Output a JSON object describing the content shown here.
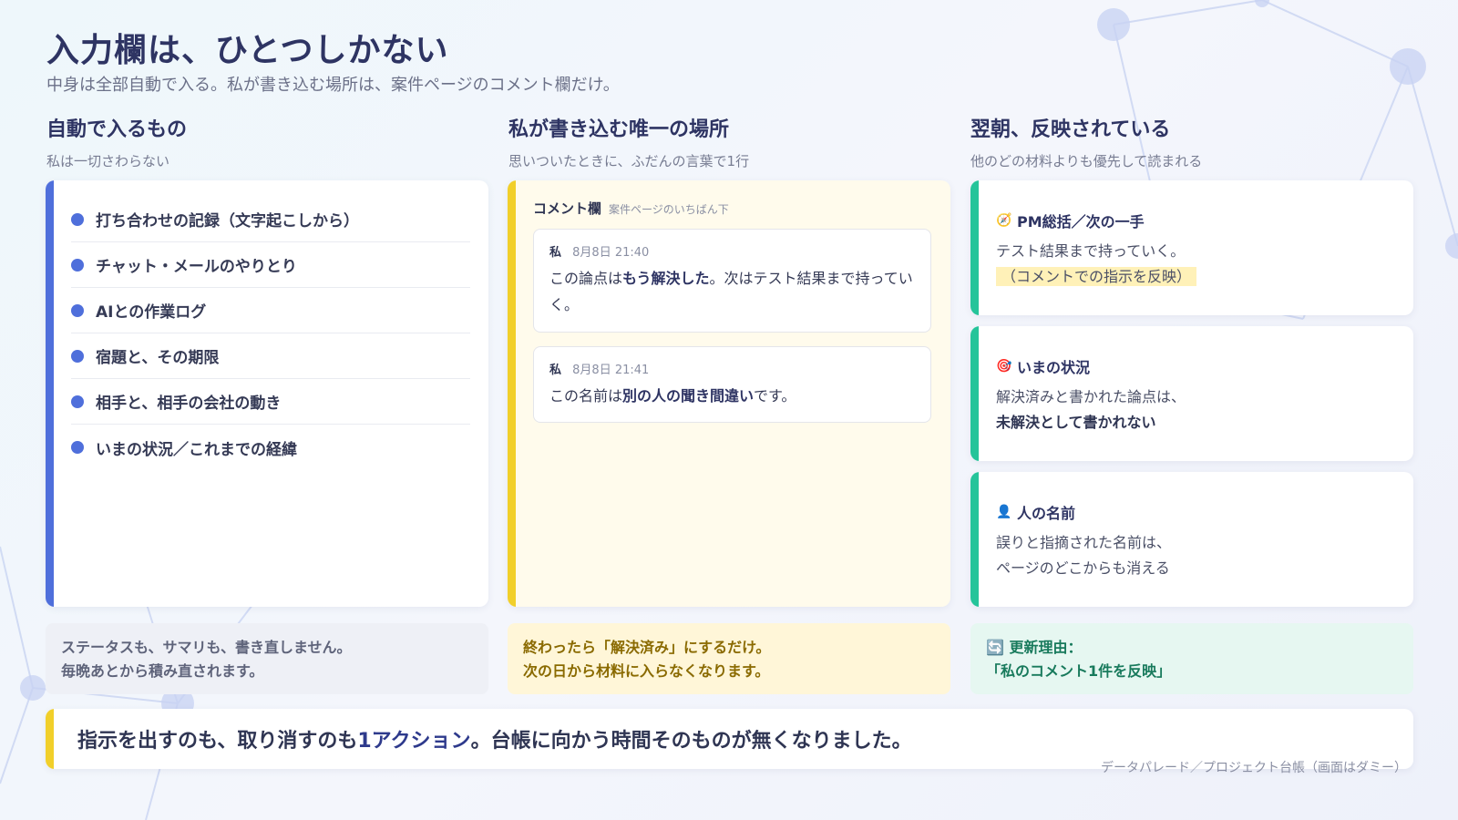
{
  "title": "入力欄は、ひとつしかない",
  "subtitle": "中身は全部自動で入る。私が書き込む場所は、案件ページのコメント欄だけ。",
  "colors": {
    "blue": "#4f6fdb",
    "yellow": "#f1cf2a",
    "green": "#25c49a",
    "navy": "#2e3463"
  },
  "columns": [
    {
      "title": "自動で入るもの",
      "sub": "私は一切さわらない"
    },
    {
      "title": "私が書き込む唯一の場所",
      "sub": "思いついたときに、ふだんの言葉で1行"
    },
    {
      "title": "翌朝、反映されている",
      "sub": "他のどの材料よりも優先して読まれる"
    }
  ],
  "auto_items": [
    "打ち合わせの記録（文字起こしから）",
    "チャット・メールのやりとり",
    "AIとの作業ログ",
    "宿題と、その期限",
    "相手と、相手の会社の動き",
    "いまの状況／これまでの経緯"
  ],
  "comment_box": {
    "label": "コメント欄",
    "sub": "案件ページのいちばん下",
    "comments": [
      {
        "author": "私",
        "time": "8月8日 21:40",
        "pre": "この論点は",
        "bold": "もう解決した",
        "post": "。次はテスト結果まで持っていく。"
      },
      {
        "author": "私",
        "time": "8月8日 21:41",
        "pre": "この名前は",
        "bold": "別の人の聞き間違い",
        "post": "です。"
      }
    ]
  },
  "results": [
    {
      "icon": "compass-icon",
      "glyph": "🧭",
      "title": "PM総括／次の一手",
      "line1": "テスト結果まで持っていく。",
      "line2": "（コメントでの指示を反映）"
    },
    {
      "icon": "target-icon",
      "glyph": "🎯",
      "title": "いまの状況",
      "line1": "解決済みと書かれた論点は、",
      "line2": "未解決として書かれない"
    },
    {
      "icon": "person-icon",
      "glyph": "👤",
      "title": "人の名前",
      "line1": "誤りと指摘された名前は、",
      "line2": "ページのどこからも消える"
    }
  ],
  "notes": {
    "n1a": "ステータスも、サマリも、書き直しません。",
    "n1b": "毎晩あとから積み直されます。",
    "n2a": "終わったら「解決済み」にするだけ。",
    "n2b": "次の日から材料に入らなくなります。",
    "n3_icon": "refresh-icon",
    "n3a": "🔄 更新理由：",
    "n3b": "「私のコメント1件を反映」"
  },
  "banner": {
    "pre": "指示を出すのも、取り消すのも",
    "em": "1アクション",
    "post": "。台帳に向かう時間そのものが無くなりました。"
  },
  "footer": "データパレード／プロジェクト台帳（画面はダミー）"
}
